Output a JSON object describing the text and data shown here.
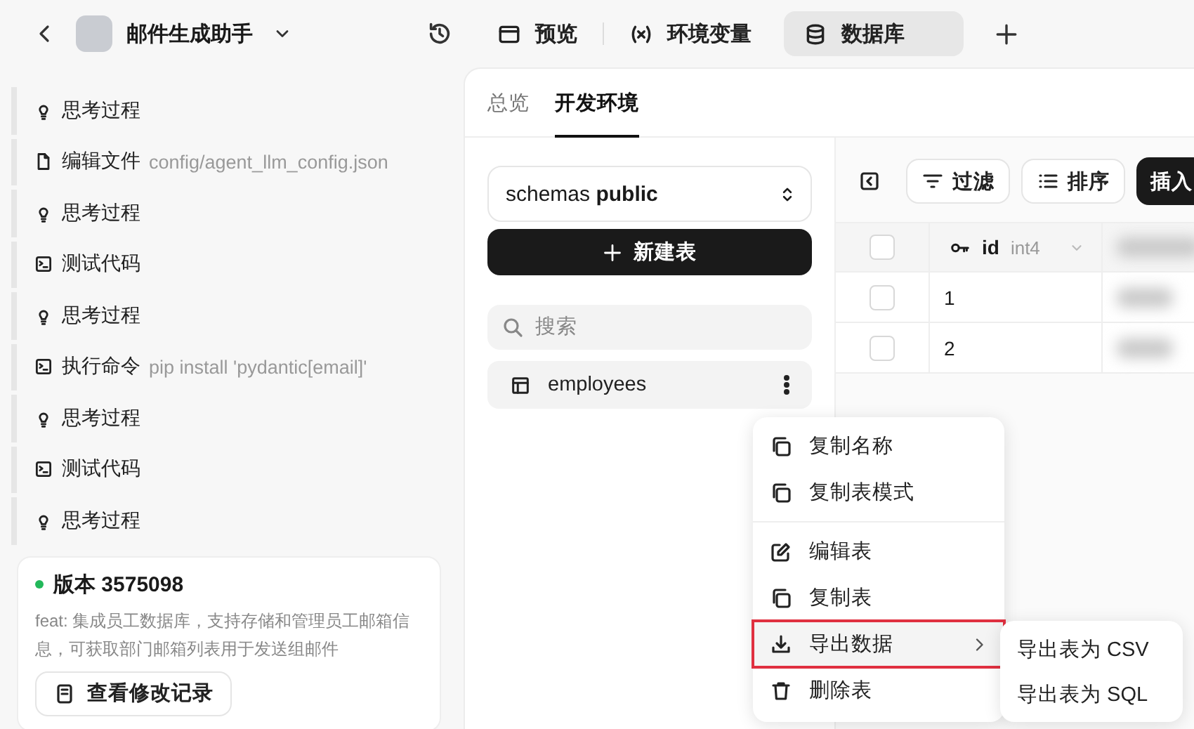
{
  "header": {
    "title": "邮件生成助手",
    "tabs": [
      {
        "kind": "window",
        "label": "预览",
        "selected": false
      },
      {
        "kind": "variable",
        "label": "环境变量",
        "selected": false
      },
      {
        "kind": "database",
        "label": "数据库",
        "selected": true
      }
    ]
  },
  "log": [
    {
      "kind": "think",
      "label": "思考过程"
    },
    {
      "kind": "file",
      "label": "编辑文件",
      "detail": "config/agent_llm_config.json"
    },
    {
      "kind": "think",
      "label": "思考过程"
    },
    {
      "kind": "code",
      "label": "测试代码"
    },
    {
      "kind": "think",
      "label": "思考过程"
    },
    {
      "kind": "code",
      "label": "执行命令",
      "detail": "pip install 'pydantic[email]'"
    },
    {
      "kind": "think",
      "label": "思考过程"
    },
    {
      "kind": "code",
      "label": "测试代码"
    },
    {
      "kind": "think",
      "label": "思考过程"
    }
  ],
  "version": {
    "title": "版本 3575098",
    "message": "feat: 集成员工数据库，支持存储和管理员工邮箱信息，可获取部门邮箱列表用于发送组邮件",
    "button": "查看修改记录"
  },
  "subtabs": [
    {
      "label": "总览",
      "selected": false
    },
    {
      "label": "开发环境",
      "selected": true
    }
  ],
  "schema": {
    "prefix": "schemas",
    "value": "public"
  },
  "new_table_button": "新建表",
  "search": {
    "placeholder": "搜索"
  },
  "tables": [
    {
      "name": "employees",
      "selected": true
    }
  ],
  "toolbar": {
    "filter": "过滤",
    "sort": "排序",
    "insert": "插入"
  },
  "grid": {
    "header_checked": false,
    "columns": [
      {
        "name": "id",
        "type": "int4",
        "primary_key": true
      }
    ],
    "rows": [
      {
        "id": "1",
        "checked": false
      },
      {
        "id": "2",
        "checked": false
      }
    ]
  },
  "context_menu": {
    "groups": [
      [
        {
          "kind": "copy",
          "label": "复制名称",
          "selected": false,
          "submenu": false
        },
        {
          "kind": "copy",
          "label": "复制表模式",
          "selected": false,
          "submenu": false
        }
      ],
      [
        {
          "kind": "edit",
          "label": "编辑表",
          "selected": false,
          "submenu": false
        },
        {
          "kind": "copy",
          "label": "复制表",
          "selected": false,
          "submenu": false
        },
        {
          "kind": "download",
          "label": "导出数据",
          "selected": true,
          "submenu": true
        },
        {
          "kind": "trash",
          "label": "删除表",
          "selected": false,
          "submenu": false
        }
      ]
    ],
    "submenu": [
      {
        "label": "导出表为 CSV"
      },
      {
        "label": "导出表为 SQL"
      }
    ]
  }
}
